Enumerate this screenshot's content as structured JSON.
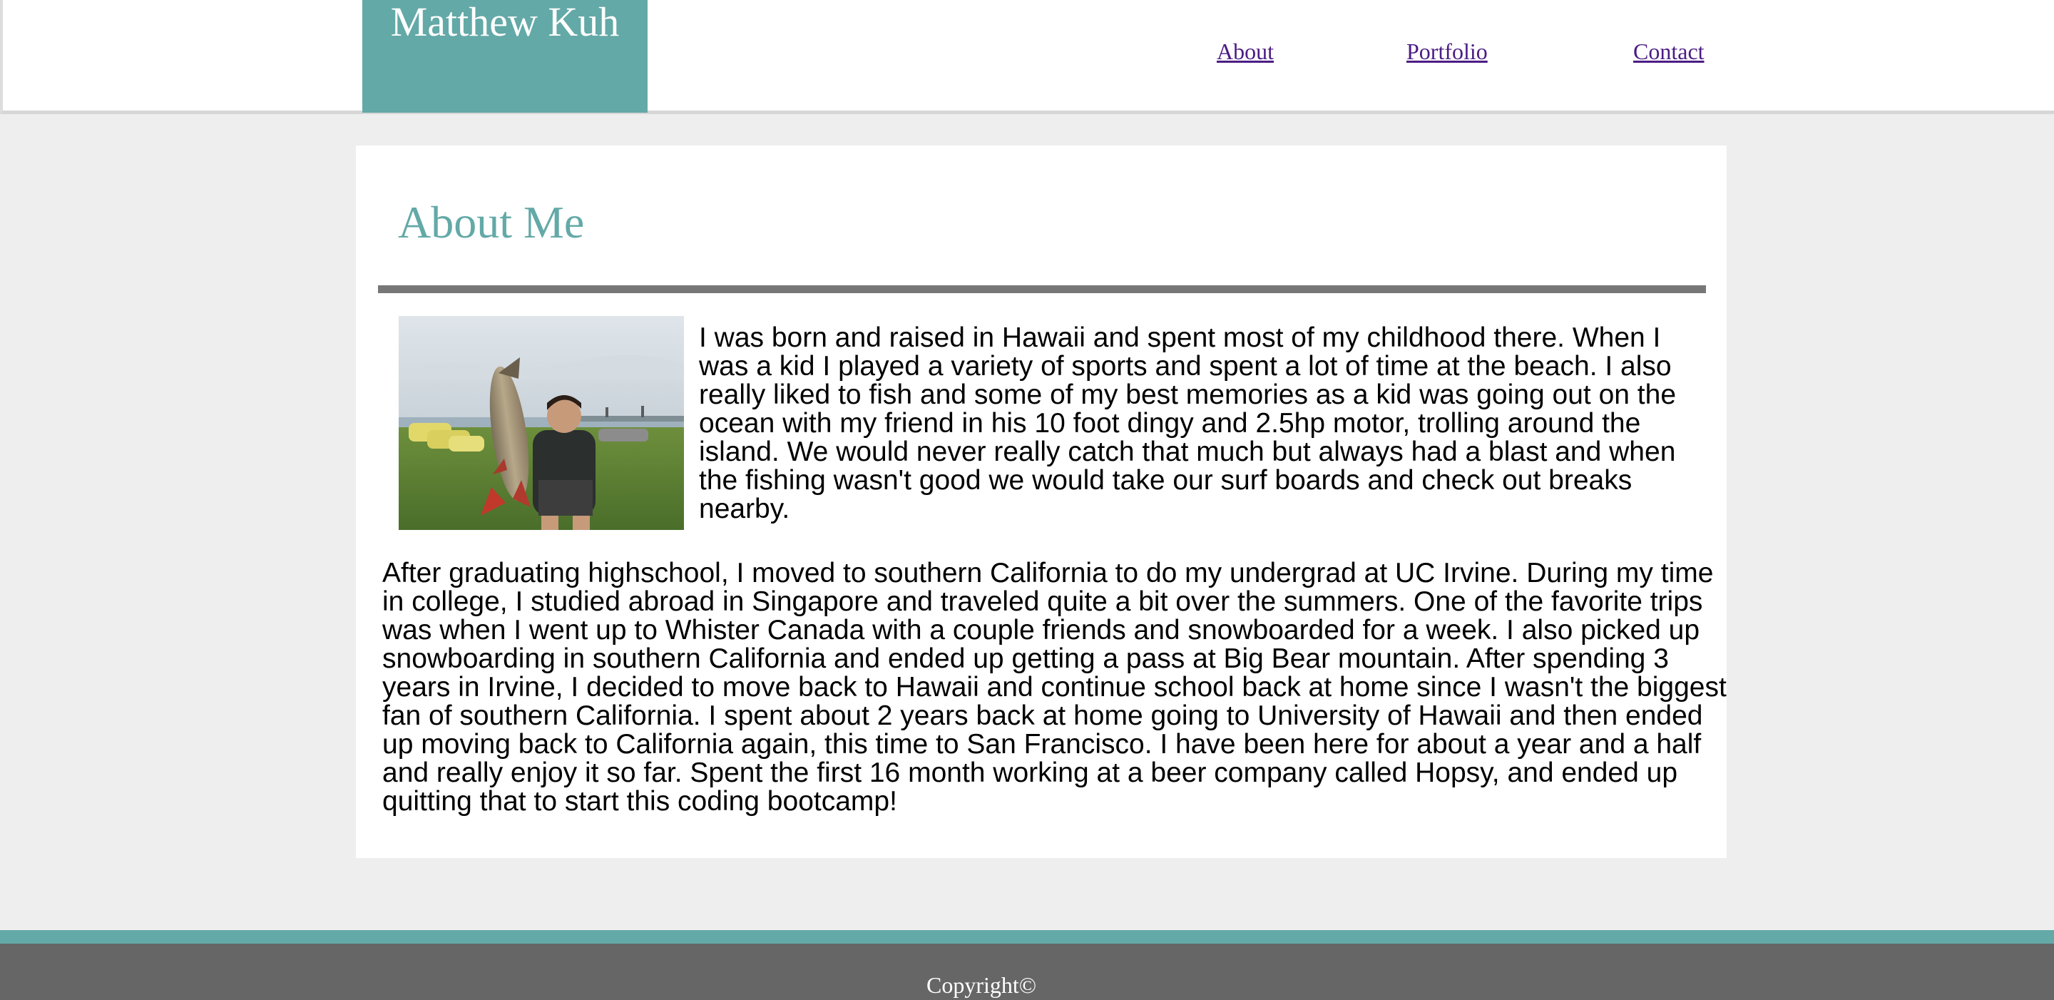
{
  "header": {
    "brand": "Matthew Kuh",
    "nav": {
      "about": "About",
      "portfolio": "Portfolio",
      "contact": "Contact"
    }
  },
  "main": {
    "title": "About Me",
    "paragraphs": [
      "I was born and raised in Hawaii and spent most of my childhood there. When I was a kid I played a variety of sports and spent a lot of time at the beach. I also really liked to fish and some of my best memories as a kid was going out on the ocean with my friend in his 10 foot dingy and 2.5hp motor, trolling around the island. We would never really catch that much but always had a blast and when the fishing wasn't good we would take our surf boards and check out breaks nearby.",
      "After graduating highschool, I moved to southern California to do my undergrad at UC Irvine. During my time in college, I studied abroad in Singapore and traveled quite a bit over the summers. One of the favorite trips was when I went up to Whister Canada with a couple friends and snowboarded for a week. I also picked up snowboarding in southern California and ended up getting a pass at Big Bear mountain. After spending 3 years in Irvine, I decided to move back to Hawaii and continue school back at home since I wasn't the biggest fan of southern California. I spent about 2 years back at home going to University of Hawaii and then ended up moving back to California again, this time to San Francisco. I have been here for about a year and a half and really enjoy it so far. Spent the first 16 month working at a beer company called Hopsy, and ended up quitting that to start this coding bootcamp!"
    ]
  },
  "footer": {
    "copyright": "Copyright©"
  },
  "colors": {
    "accent": "#63a9a7",
    "nav_link": "#4b1c84",
    "footer": "#666666",
    "divider": "#777777",
    "background": "#eeeeee"
  }
}
